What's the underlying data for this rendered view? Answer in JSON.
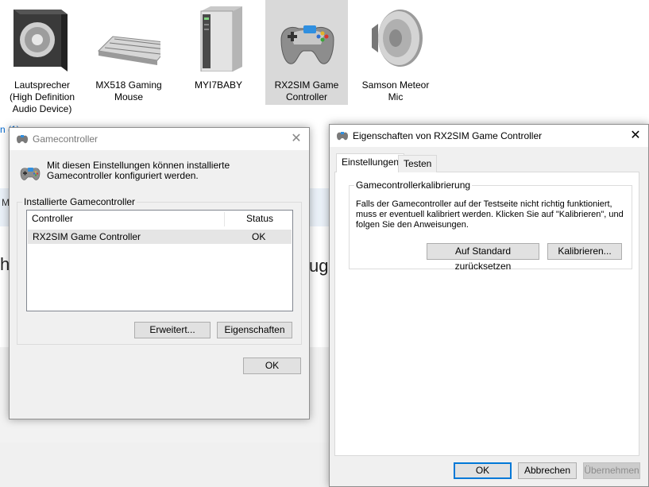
{
  "devices": [
    {
      "name": "Lautsprecher (High Definition Audio Device)",
      "lines": [
        "Lautsprecher",
        "(High Definition",
        "Audio Device)"
      ],
      "icon": "speaker-box-icon"
    },
    {
      "name": "MX518 Gaming Mouse",
      "lines": [
        "MX518 Gaming",
        "Mouse"
      ],
      "icon": "keyboard-icon"
    },
    {
      "name": "MYI7BABY",
      "lines": [
        "MYI7BABY"
      ],
      "icon": "computer-tower-icon"
    },
    {
      "name": "RX2SIM Game Controller",
      "lines": [
        "RX2SIM Game",
        "Controller"
      ],
      "icon": "gamepad-icon",
      "selected": true
    },
    {
      "name": "Samson Meteor Mic",
      "lines": [
        "Samson Meteor",
        "Mic"
      ],
      "icon": "loudspeaker-icon"
    }
  ],
  "background": {
    "link_text": "n (1)",
    "band_text": "M",
    "big_left": "ha",
    "big_right": "ug."
  },
  "gc_dialog": {
    "title": "Gamecontroller",
    "close": "✕",
    "description": "Mit diesen Einstellungen können installierte Gamecontroller konfiguriert werden.",
    "group_title": "Installierte Gamecontroller",
    "columns": {
      "controller": "Controller",
      "status": "Status"
    },
    "rows": [
      {
        "controller": "RX2SIM Game Controller",
        "status": "OK"
      }
    ],
    "buttons": {
      "advanced": "Erweitert...",
      "properties": "Eigenschaften",
      "ok": "OK"
    }
  },
  "props_dialog": {
    "title": "Eigenschaften von RX2SIM Game Controller",
    "close": "✕",
    "tabs": [
      {
        "label": "Einstellungen",
        "active": true
      },
      {
        "label": "Testen",
        "active": false
      }
    ],
    "group_title": "Gamecontrollerkalibrierung",
    "description": "Falls der Gamecontroller auf der Testseite nicht richtig funktioniert, muss er eventuell kalibriert werden. Klicken Sie auf \"Kalibrieren\", und folgen Sie den Anweisungen.",
    "buttons": {
      "reset": "Auf Standard zurücksetzen",
      "calibrate": "Kalibrieren...",
      "ok": "OK",
      "cancel": "Abbrechen",
      "apply": "Übernehmen"
    }
  },
  "colors": {
    "accent": "#0078d7",
    "selection": "#d9d9d9",
    "dialog_bg": "#f0f0f0",
    "row_highlight": "#e5e5e5"
  }
}
